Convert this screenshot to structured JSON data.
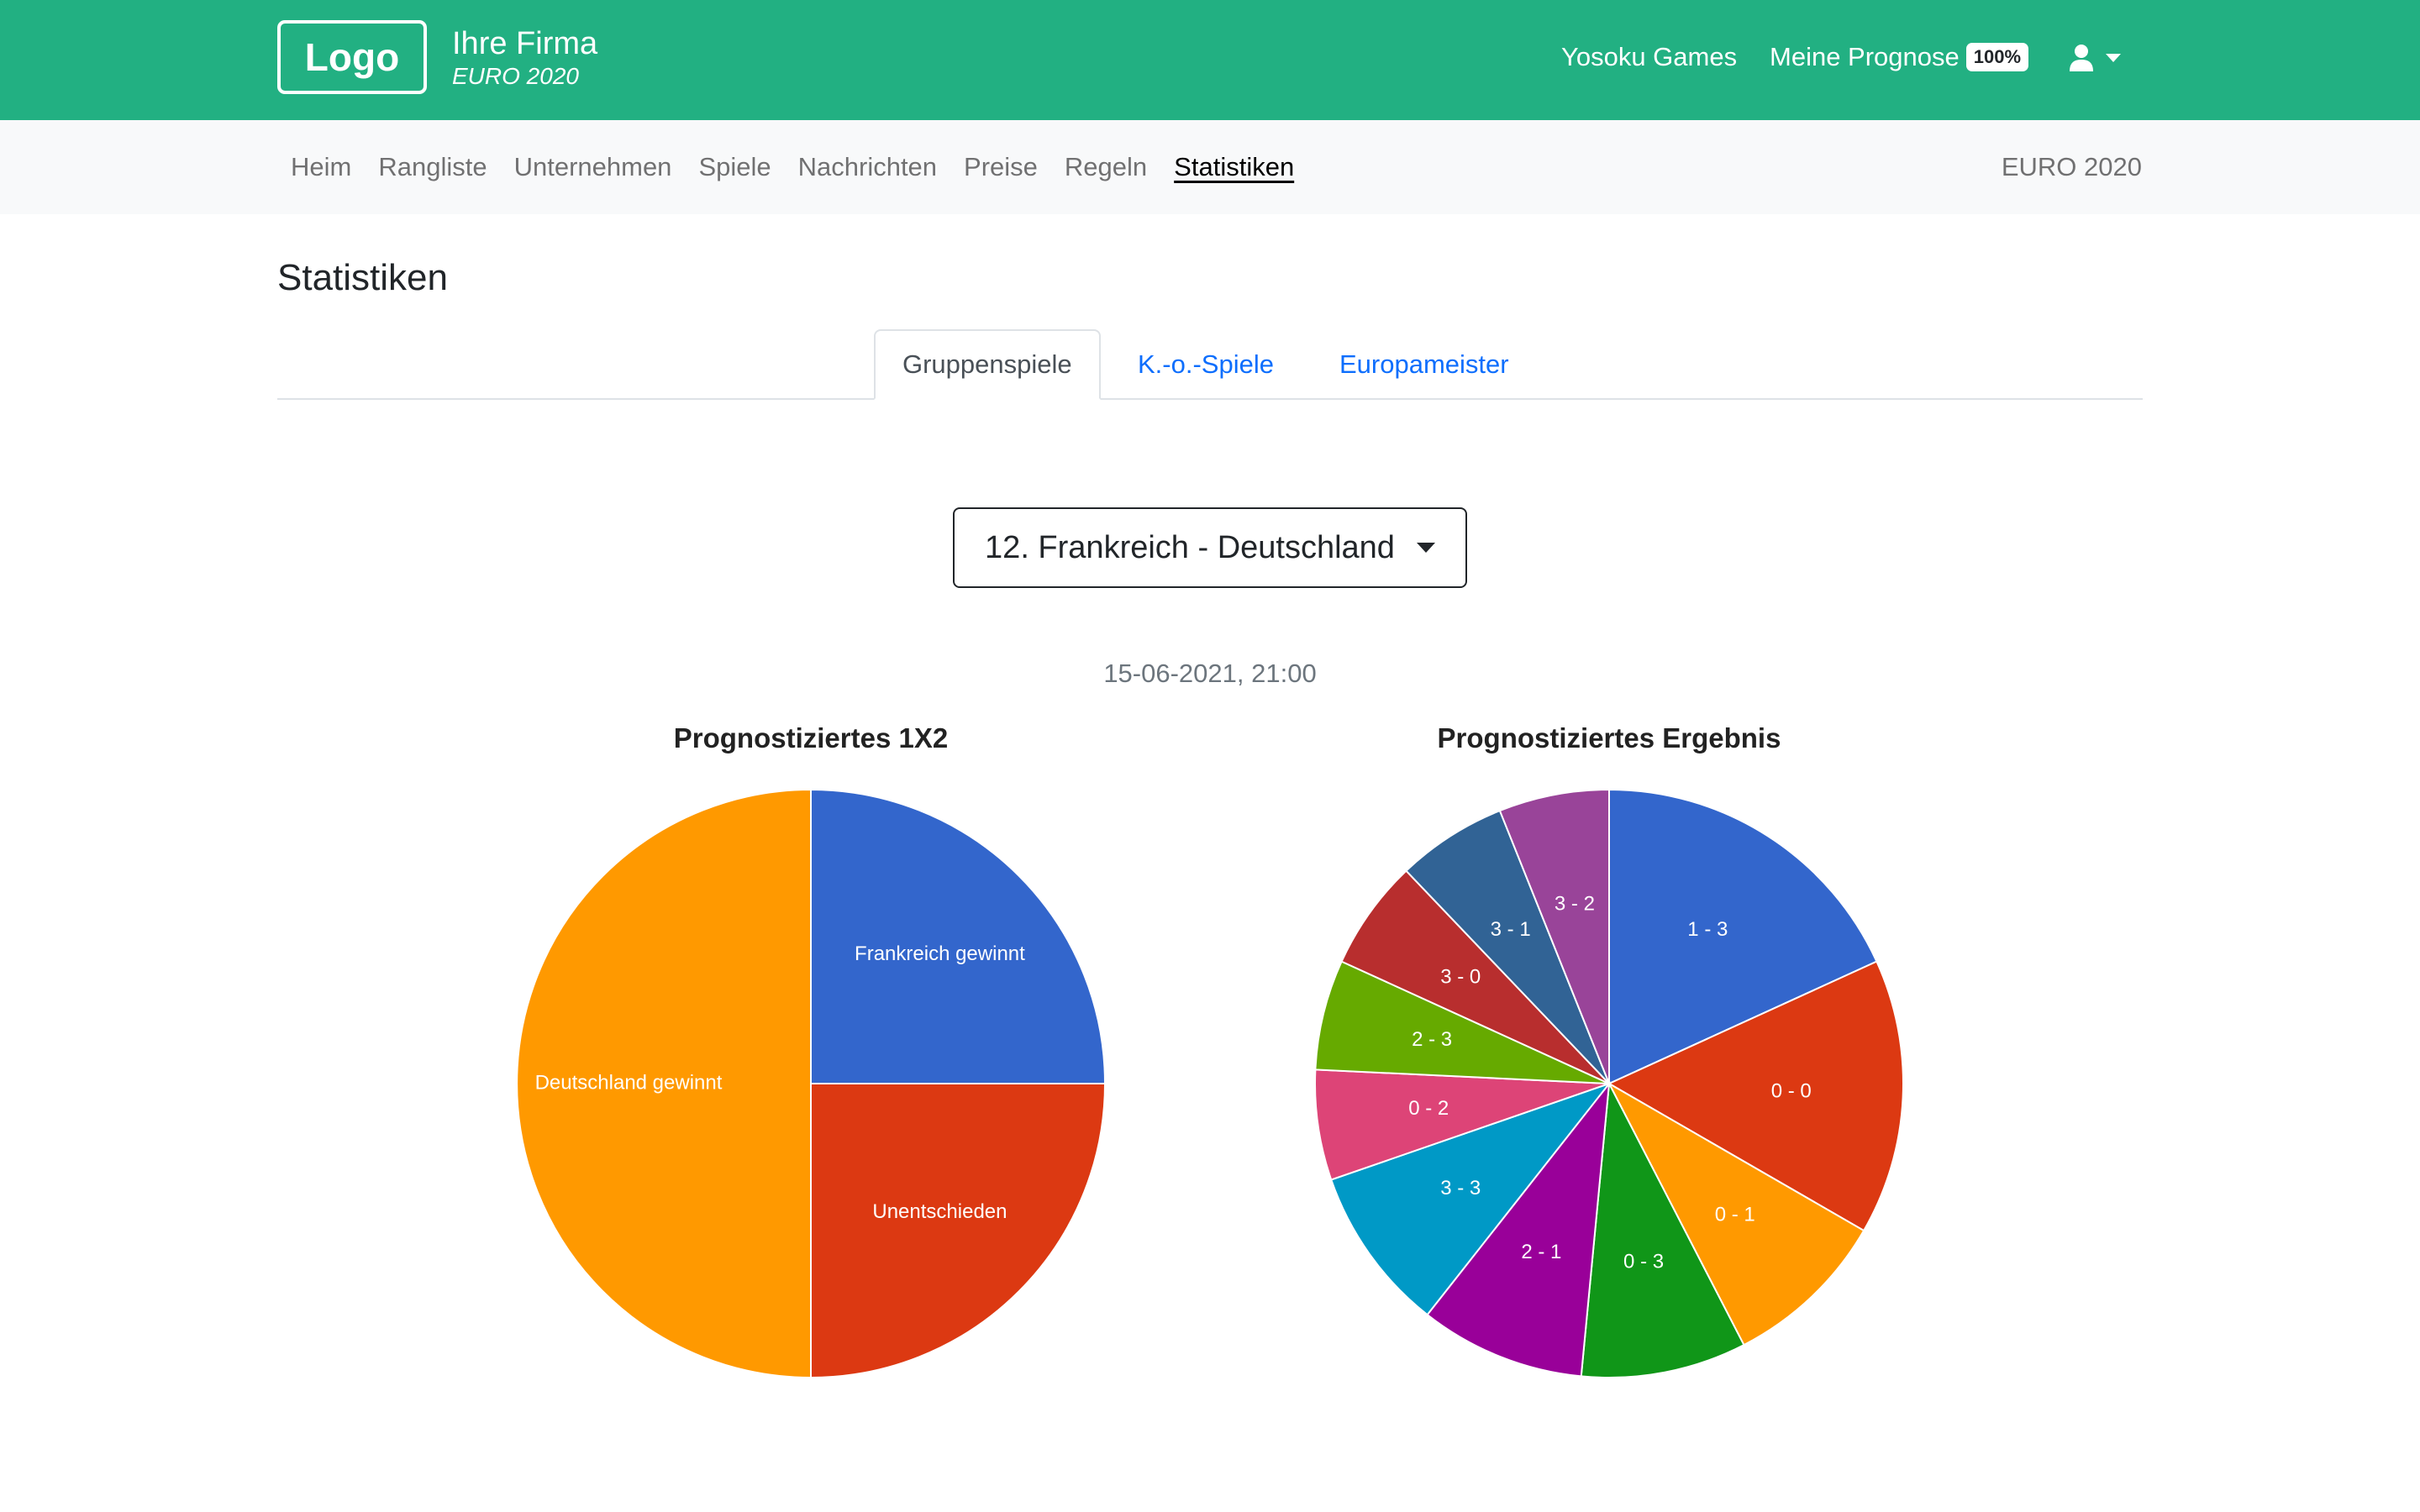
{
  "header": {
    "logo": "Logo",
    "company": "Ihre Firma",
    "tournament": "EURO 2020",
    "links": {
      "yosoku": "Yosoku Games",
      "prognose": "Meine Prognose",
      "prognose_badge": "100%"
    },
    "user_icon": "user-icon"
  },
  "nav": {
    "items": [
      "Heim",
      "Rangliste",
      "Unternehmen",
      "Spiele",
      "Nachrichten",
      "Preise",
      "Regeln",
      "Statistiken"
    ],
    "active": "Statistiken",
    "right": "EURO 2020"
  },
  "page": {
    "title": "Statistiken",
    "tabs": [
      "Gruppenspiele",
      "K.-o.-Spiele",
      "Europameister"
    ],
    "active_tab": "Gruppenspiele",
    "match_select": "12. Frankreich - Deutschland",
    "match_date": "15-06-2021, 21:00"
  },
  "chart_data": [
    {
      "type": "pie",
      "title": "Prognostiziertes 1X2",
      "start_angle_deg": 0,
      "slices": [
        {
          "label": "Frankreich gewinnt",
          "value": 25,
          "color": "#3366cc"
        },
        {
          "label": "Unentschieden",
          "value": 25,
          "color": "#dc3912"
        },
        {
          "label": "Deutschland gewinnt",
          "value": 50,
          "color": "#ff9900"
        }
      ]
    },
    {
      "type": "pie",
      "title": "Prognostiziertes Ergebnis",
      "start_angle_deg": 0,
      "slices": [
        {
          "label": "1 - 3",
          "value": 15.0,
          "color": "#3366cc"
        },
        {
          "label": "0 - 0",
          "value": 12.5,
          "color": "#dc3912"
        },
        {
          "label": "0 - 1",
          "value": 7.5,
          "color": "#ff9900"
        },
        {
          "label": "0 - 3",
          "value": 7.5,
          "color": "#109618"
        },
        {
          "label": "2 - 1",
          "value": 7.5,
          "color": "#990099"
        },
        {
          "label": "3 - 3",
          "value": 7.5,
          "color": "#0099c6"
        },
        {
          "label": "0 - 2",
          "value": 5.0,
          "color": "#dd4477"
        },
        {
          "label": "2 - 3",
          "value": 5.0,
          "color": "#66aa00"
        },
        {
          "label": "3 - 0",
          "value": 5.0,
          "color": "#b82e2e"
        },
        {
          "label": "3 - 1",
          "value": 5.0,
          "color": "#316395"
        },
        {
          "label": "3 - 2",
          "value": 5.0,
          "color": "#994499"
        }
      ]
    }
  ]
}
